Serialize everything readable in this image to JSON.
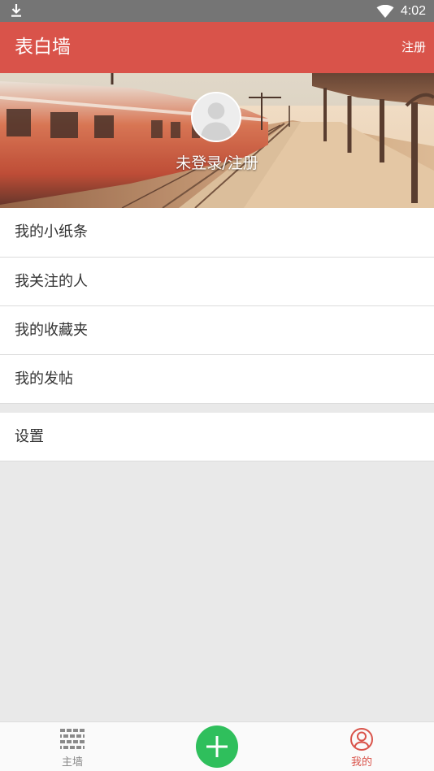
{
  "status_bar": {
    "time": "4:02",
    "icons": [
      "download-icon",
      "wifi-icon"
    ]
  },
  "app_bar": {
    "title": "表白墙",
    "action": "注册",
    "color": "#d9534a"
  },
  "profile": {
    "login_text": "未登录/注册",
    "avatar_icon": "user-avatar-icon"
  },
  "menu": {
    "items": [
      {
        "label": "我的小纸条"
      },
      {
        "label": "我关注的人"
      },
      {
        "label": "我的收藏夹"
      },
      {
        "label": "我的发帖"
      }
    ],
    "settings": {
      "label": "设置"
    }
  },
  "bottom_nav": {
    "home": {
      "label": "主墙",
      "icon": "brick-wall-icon"
    },
    "add": {
      "icon": "plus-icon",
      "color": "#2fbf5c"
    },
    "mine": {
      "label": "我的",
      "icon": "user-circle-icon",
      "active_color": "#d9534a"
    }
  }
}
